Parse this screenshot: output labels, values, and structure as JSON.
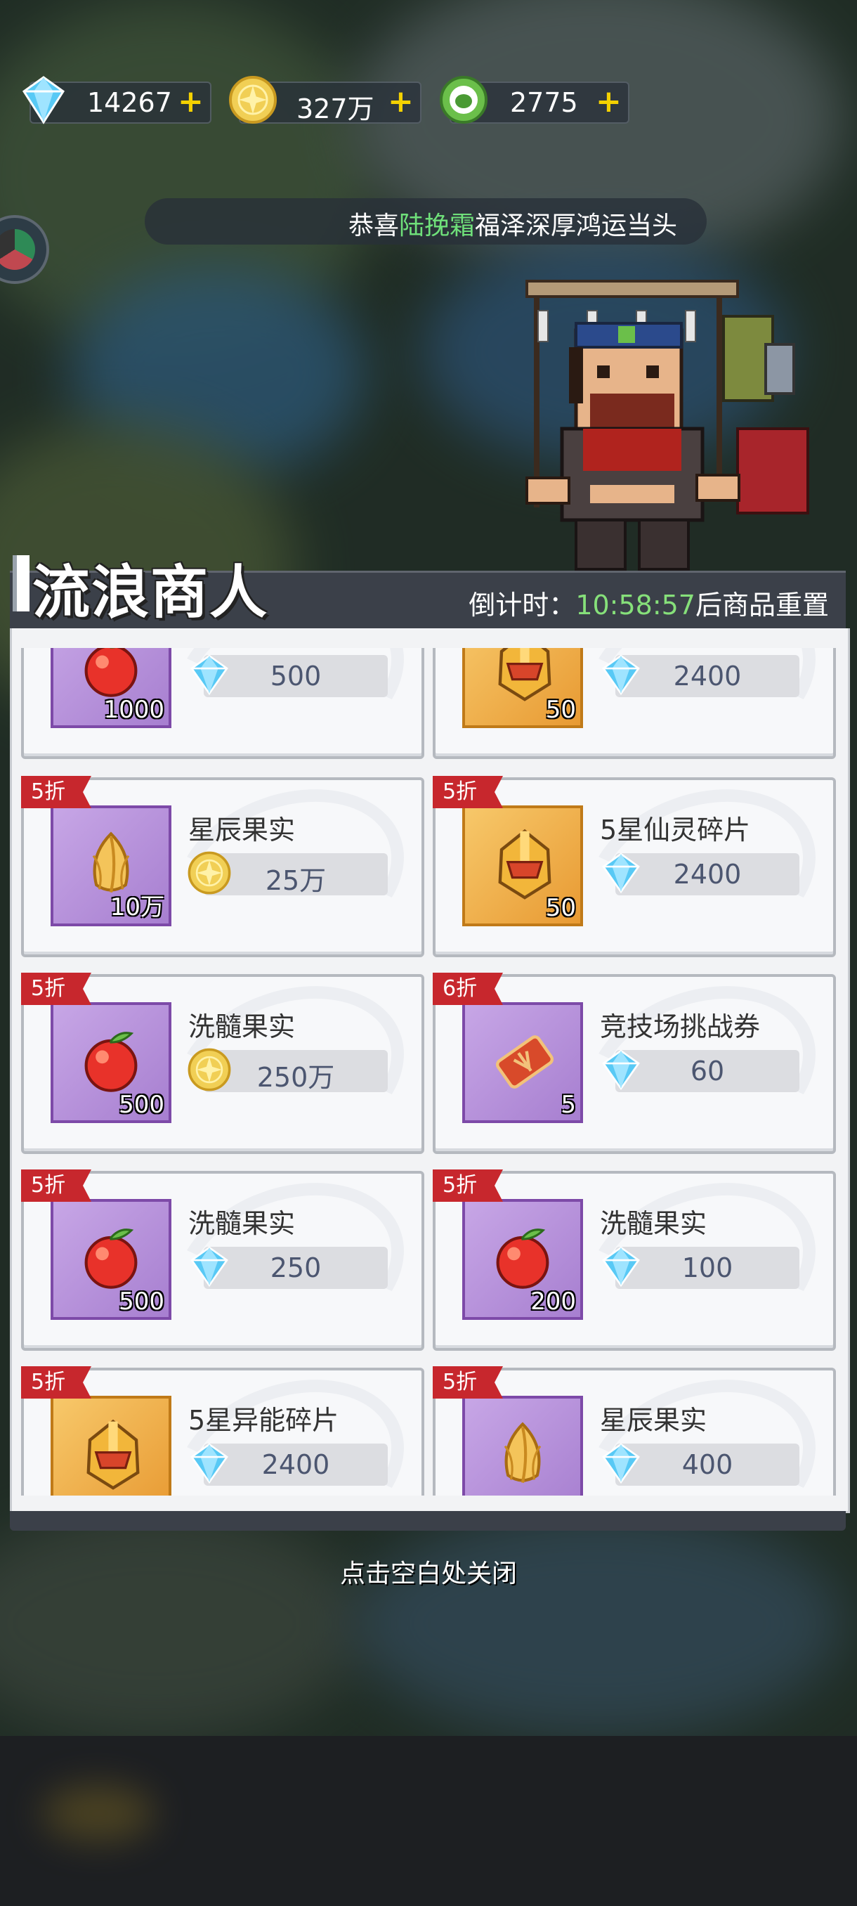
{
  "resources": [
    {
      "icon": "diamond-icon",
      "value": "14267"
    },
    {
      "icon": "gold-coin-icon",
      "value": "327万"
    },
    {
      "icon": "green-token-icon",
      "value": "2775"
    }
  ],
  "marquee": {
    "prefix": "恭喜",
    "name": "陆挽霜",
    "suffix": "福泽深厚鸿运当头"
  },
  "panel": {
    "title": "流浪商人",
    "timer_prefix": "倒计时：",
    "timer_value": "10:58:57",
    "timer_suffix": "后商品重置"
  },
  "items": [
    {
      "badge": "",
      "name": "",
      "icon": "red-fruit-icon",
      "box": "purple",
      "qty": "1000",
      "currency": "diamond-icon",
      "price": "500"
    },
    {
      "badge": "",
      "name": "",
      "icon": "golden-helmet-icon",
      "box": "gold",
      "qty": "50",
      "currency": "diamond-icon",
      "price": "2400"
    },
    {
      "badge": "5折",
      "name": "星辰果实",
      "icon": "golden-bud-icon",
      "box": "purple",
      "qty": "10万",
      "currency": "gold-coin-icon",
      "price": "25万"
    },
    {
      "badge": "5折",
      "name": "5星仙灵碎片",
      "icon": "golden-helmet-icon",
      "box": "gold",
      "qty": "50",
      "currency": "diamond-icon",
      "price": "2400"
    },
    {
      "badge": "5折",
      "name": "洗髓果实",
      "icon": "red-fruit-icon",
      "box": "purple",
      "qty": "500",
      "currency": "gold-coin-icon",
      "price": "250万"
    },
    {
      "badge": "6折",
      "name": "竞技场挑战券",
      "icon": "ticket-icon",
      "box": "purple",
      "qty": "5",
      "currency": "diamond-icon",
      "price": "60"
    },
    {
      "badge": "5折",
      "name": "洗髓果实",
      "icon": "red-fruit-icon",
      "box": "purple",
      "qty": "500",
      "currency": "diamond-icon",
      "price": "250"
    },
    {
      "badge": "5折",
      "name": "洗髓果实",
      "icon": "red-fruit-icon",
      "box": "purple",
      "qty": "200",
      "currency": "diamond-icon",
      "price": "100"
    },
    {
      "badge": "5折",
      "name": "5星异能碎片",
      "icon": "golden-helmet-icon",
      "box": "gold",
      "qty": "",
      "currency": "diamond-icon",
      "price": "2400"
    },
    {
      "badge": "5折",
      "name": "星辰果实",
      "icon": "golden-bud-icon",
      "box": "purple",
      "qty": "",
      "currency": "diamond-icon",
      "price": "400"
    }
  ],
  "close_hint": "点击空白处关闭"
}
